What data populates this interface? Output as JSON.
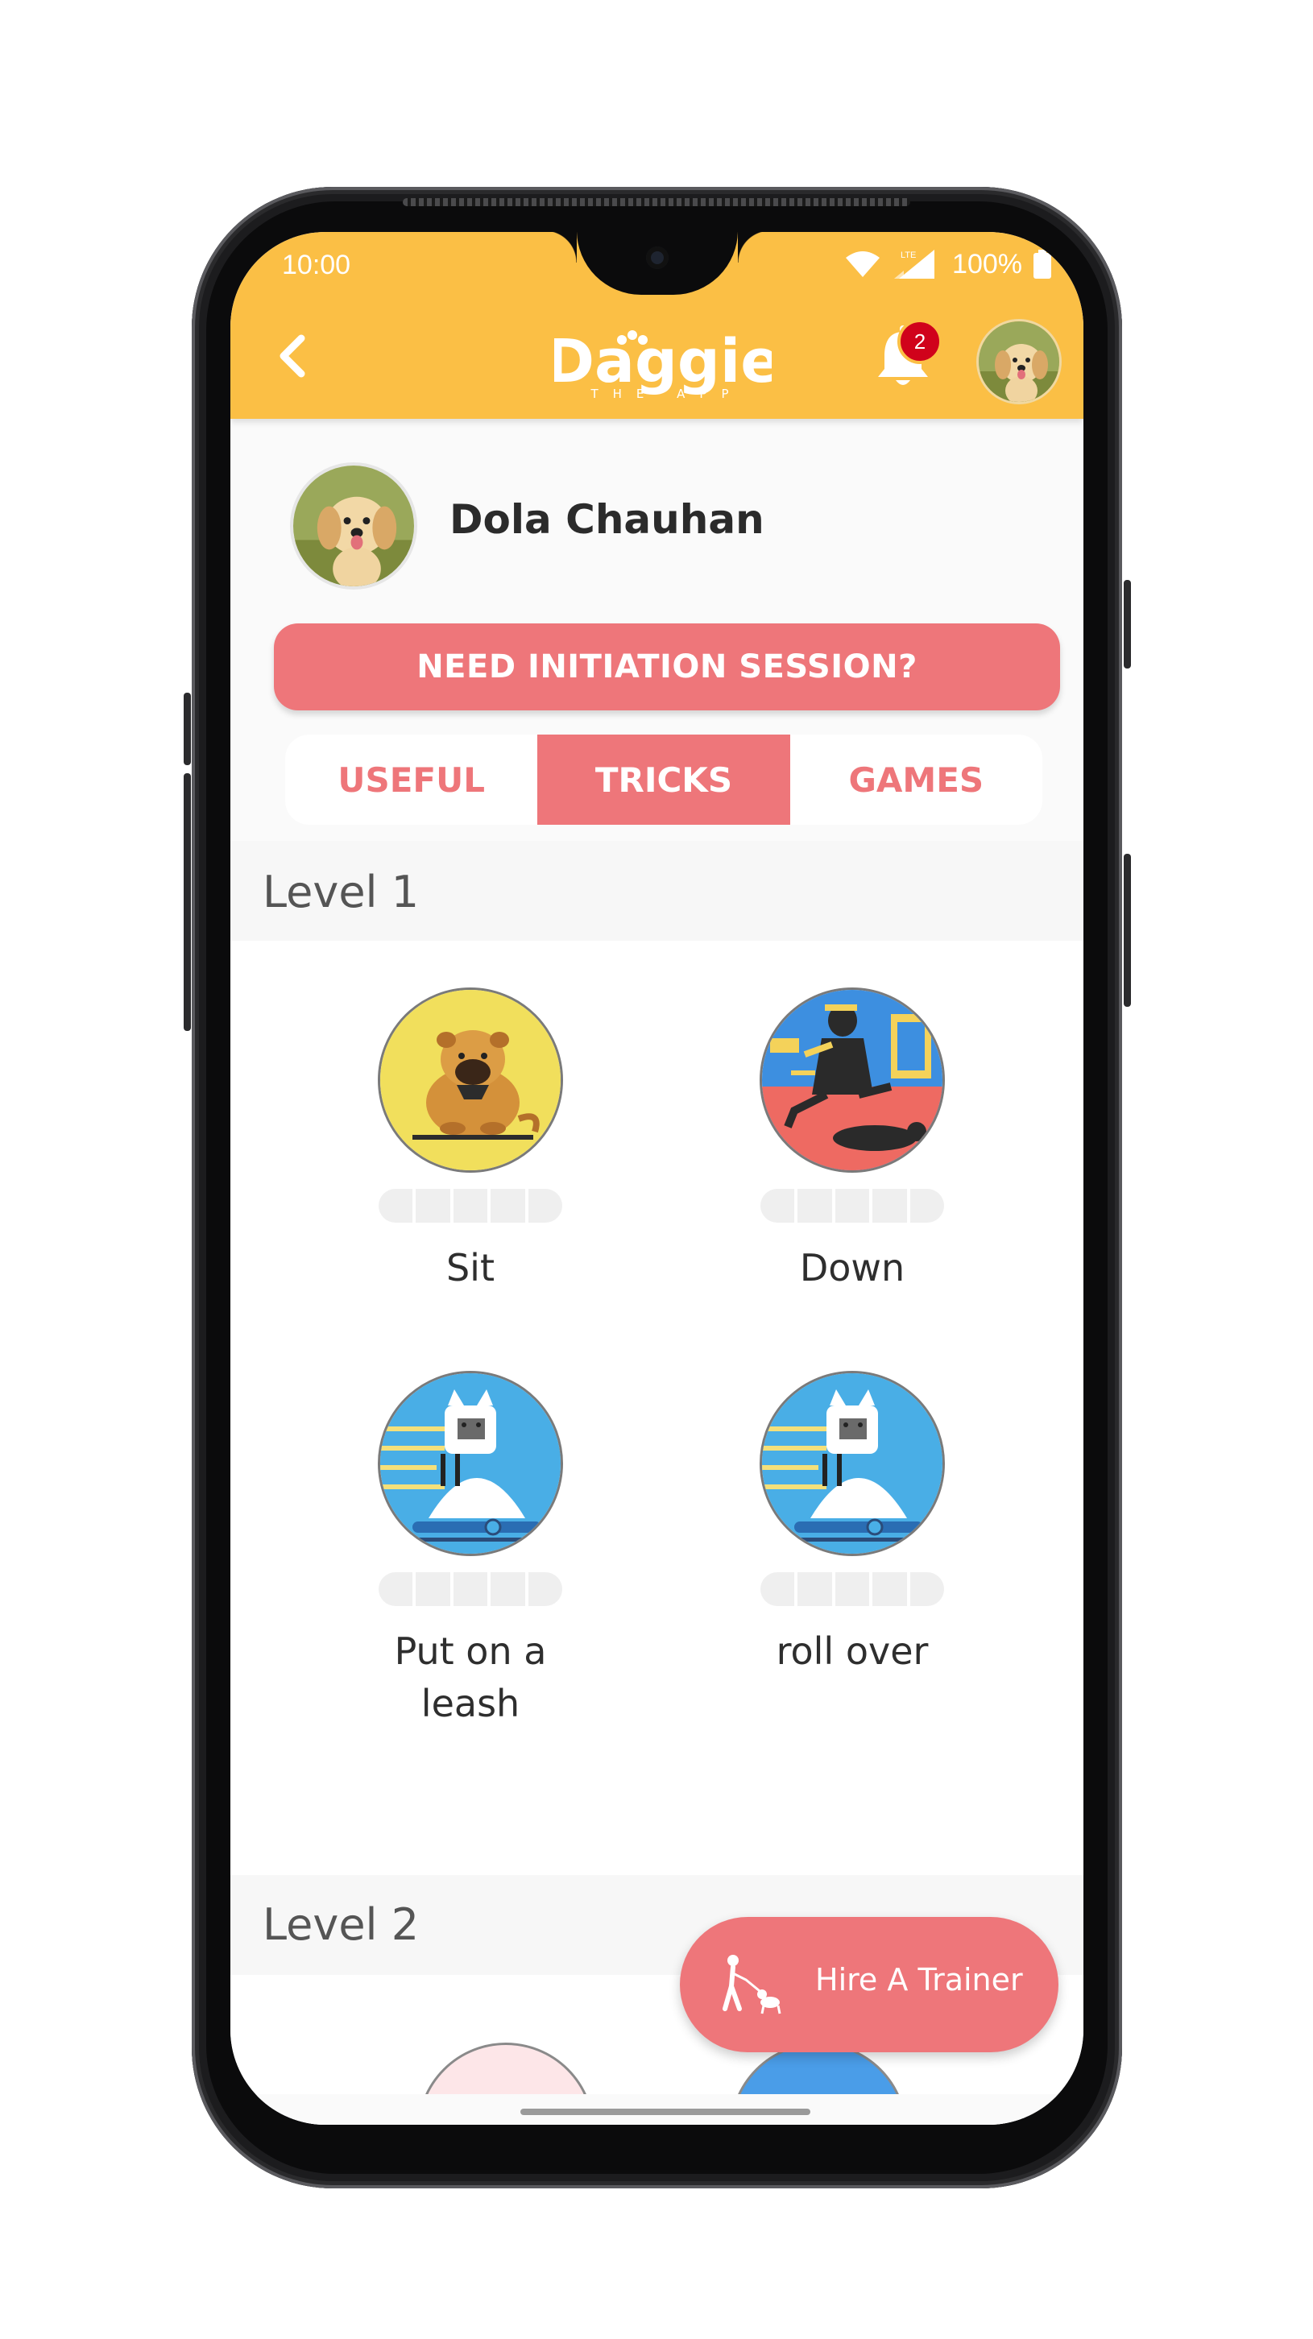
{
  "status_bar": {
    "time": "10:00",
    "battery": "100%",
    "network": "LTE"
  },
  "header": {
    "logo_text": "Daggie",
    "logo_subtext": "THE APP",
    "notification_count": "2"
  },
  "profile": {
    "name": "Dola Chauhan"
  },
  "initiation_button": "NEED INITIATION SESSION?",
  "tabs": [
    {
      "label": "USEFUL",
      "active": false
    },
    {
      "label": "TRICKS",
      "active": true
    },
    {
      "label": "GAMES",
      "active": false
    }
  ],
  "levels": [
    {
      "title": "Level 1",
      "tricks": [
        {
          "label": "Sit",
          "icon": "sitting-dog-icon",
          "progress": 0
        },
        {
          "label": "Down",
          "icon": "woman-with-dog-icon",
          "progress": 0
        },
        {
          "label": "Put on a leash",
          "icon": "dog-on-treadmill-icon",
          "progress": 0
        },
        {
          "label": "roll over",
          "icon": "dog-on-treadmill-icon",
          "progress": 0
        }
      ]
    },
    {
      "title": "Level 2",
      "tricks": []
    }
  ],
  "hire_button": "Hire A Trainer",
  "colors": {
    "accent": "#ee767a",
    "header": "#fbbf45",
    "badge": "#d0021b"
  }
}
